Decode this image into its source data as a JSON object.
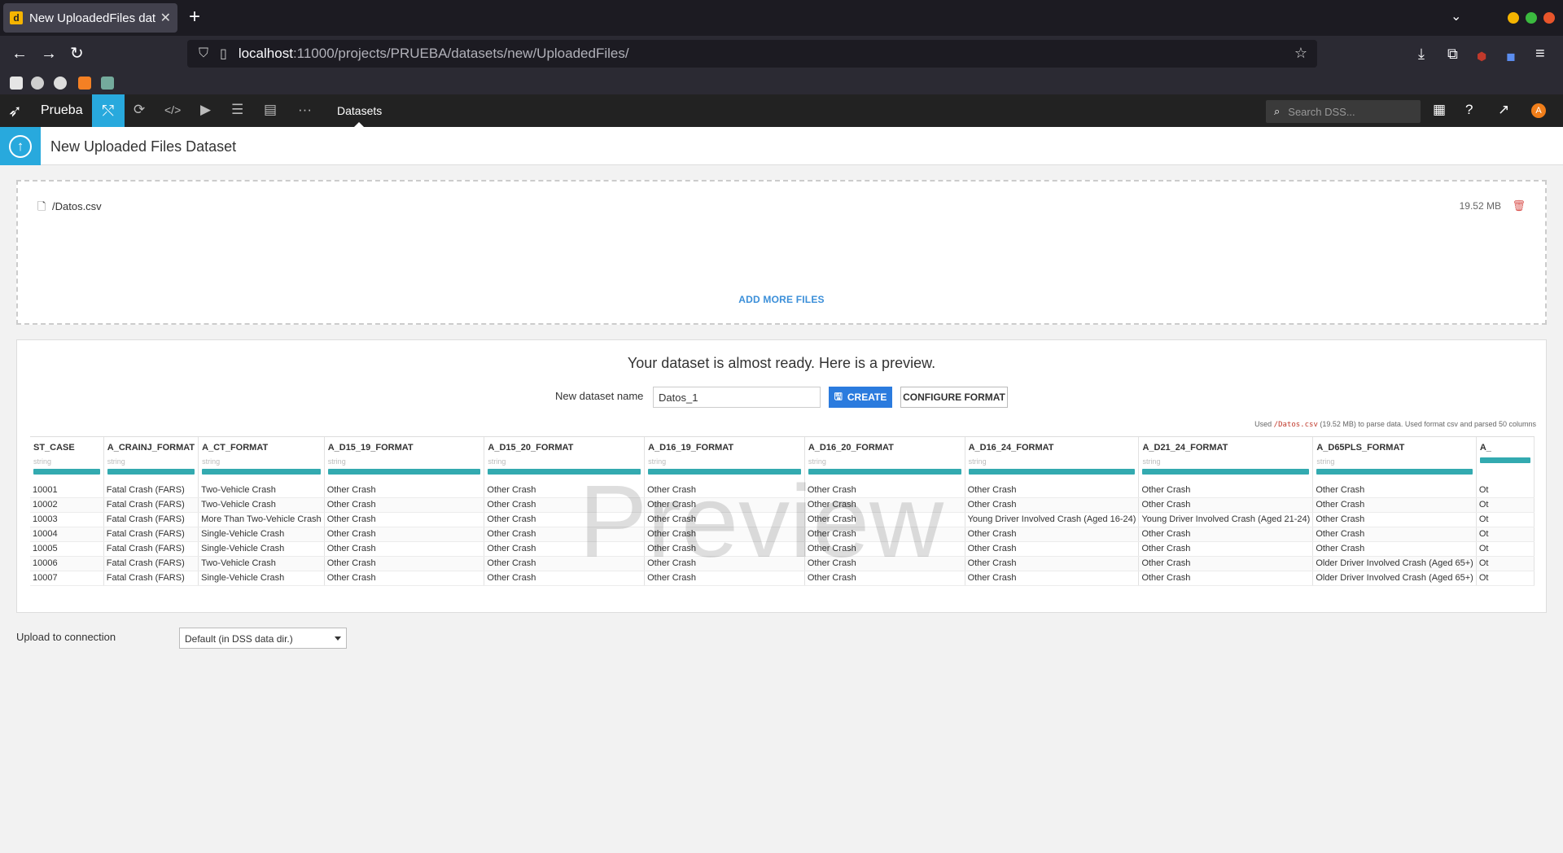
{
  "browser": {
    "tab_title": "New UploadedFiles datas",
    "tab_favicon": "d",
    "url_host": "localhost",
    "url_path": ":11000/projects/PRUEBA/datasets/new/UploadedFiles/"
  },
  "dss": {
    "project": "Prueba",
    "breadcrumb": "Datasets",
    "search_placeholder": "Search DSS...",
    "avatar_letter": "A"
  },
  "page": {
    "title": "New Uploaded Files Dataset"
  },
  "upload": {
    "file_name": "/Datos.csv",
    "file_size": "19.52 MB",
    "add_more_label": "ADD MORE FILES"
  },
  "preview": {
    "heading": "Your dataset is almost ready. Here is a preview.",
    "name_label": "New dataset name",
    "name_value": "Datos_1",
    "create_label": "CREATE",
    "configure_label": "CONFIGURE FORMAT",
    "note_prefix": "Used ",
    "note_file": "/Datos.csv",
    "note_suffix": " (19.52 MB) to parse data. Used format csv and parsed 50 columns",
    "watermark": "Preview",
    "columns": [
      {
        "name": "ST_CASE",
        "type": "string"
      },
      {
        "name": "A_CRAINJ_FORMAT",
        "type": "string"
      },
      {
        "name": "A_CT_FORMAT",
        "type": "string"
      },
      {
        "name": "A_D15_19_FORMAT",
        "type": "string"
      },
      {
        "name": "A_D15_20_FORMAT",
        "type": "string"
      },
      {
        "name": "A_D16_19_FORMAT",
        "type": "string"
      },
      {
        "name": "A_D16_20_FORMAT",
        "type": "string"
      },
      {
        "name": "A_D16_24_FORMAT",
        "type": "string"
      },
      {
        "name": "A_D21_24_FORMAT",
        "type": "string"
      },
      {
        "name": "A_D65PLS_FORMAT",
        "type": "string"
      },
      {
        "name": "A_",
        "type": ""
      }
    ],
    "rows": [
      [
        "10001",
        "Fatal Crash (FARS)",
        "Two-Vehicle Crash",
        "Other Crash",
        "Other Crash",
        "Other Crash",
        "Other Crash",
        "Other Crash",
        "Other Crash",
        "Other Crash",
        "Ot"
      ],
      [
        "10002",
        "Fatal Crash (FARS)",
        "Two-Vehicle Crash",
        "Other Crash",
        "Other Crash",
        "Other Crash",
        "Other Crash",
        "Other Crash",
        "Other Crash",
        "Other Crash",
        "Ot"
      ],
      [
        "10003",
        "Fatal Crash (FARS)",
        "More Than Two-Vehicle Crash",
        "Other Crash",
        "Other Crash",
        "Other Crash",
        "Other Crash",
        "Young Driver Involved Crash (Aged 16-24)",
        "Young Driver Involved Crash (Aged 21-24)",
        "Other Crash",
        "Ot"
      ],
      [
        "10004",
        "Fatal Crash (FARS)",
        "Single-Vehicle Crash",
        "Other Crash",
        "Other Crash",
        "Other Crash",
        "Other Crash",
        "Other Crash",
        "Other Crash",
        "Other Crash",
        "Ot"
      ],
      [
        "10005",
        "Fatal Crash (FARS)",
        "Single-Vehicle Crash",
        "Other Crash",
        "Other Crash",
        "Other Crash",
        "Other Crash",
        "Other Crash",
        "Other Crash",
        "Other Crash",
        "Ot"
      ],
      [
        "10006",
        "Fatal Crash (FARS)",
        "Two-Vehicle Crash",
        "Other Crash",
        "Other Crash",
        "Other Crash",
        "Other Crash",
        "Other Crash",
        "Other Crash",
        "Older Driver Involved Crash (Aged 65+)",
        "Ot"
      ],
      [
        "10007",
        "Fatal Crash (FARS)",
        "Single-Vehicle Crash",
        "Other Crash",
        "Other Crash",
        "Other Crash",
        "Other Crash",
        "Other Crash",
        "Other Crash",
        "Older Driver Involved Crash (Aged 65+)",
        "Ot"
      ]
    ]
  },
  "connection": {
    "label": "Upload to connection",
    "selected": "Default (in DSS data dir.)"
  },
  "colors": {
    "accent": "#28a9dd",
    "create_button": "#2b7bde",
    "column_bar": "#33aab0",
    "delete": "#d9534f"
  }
}
